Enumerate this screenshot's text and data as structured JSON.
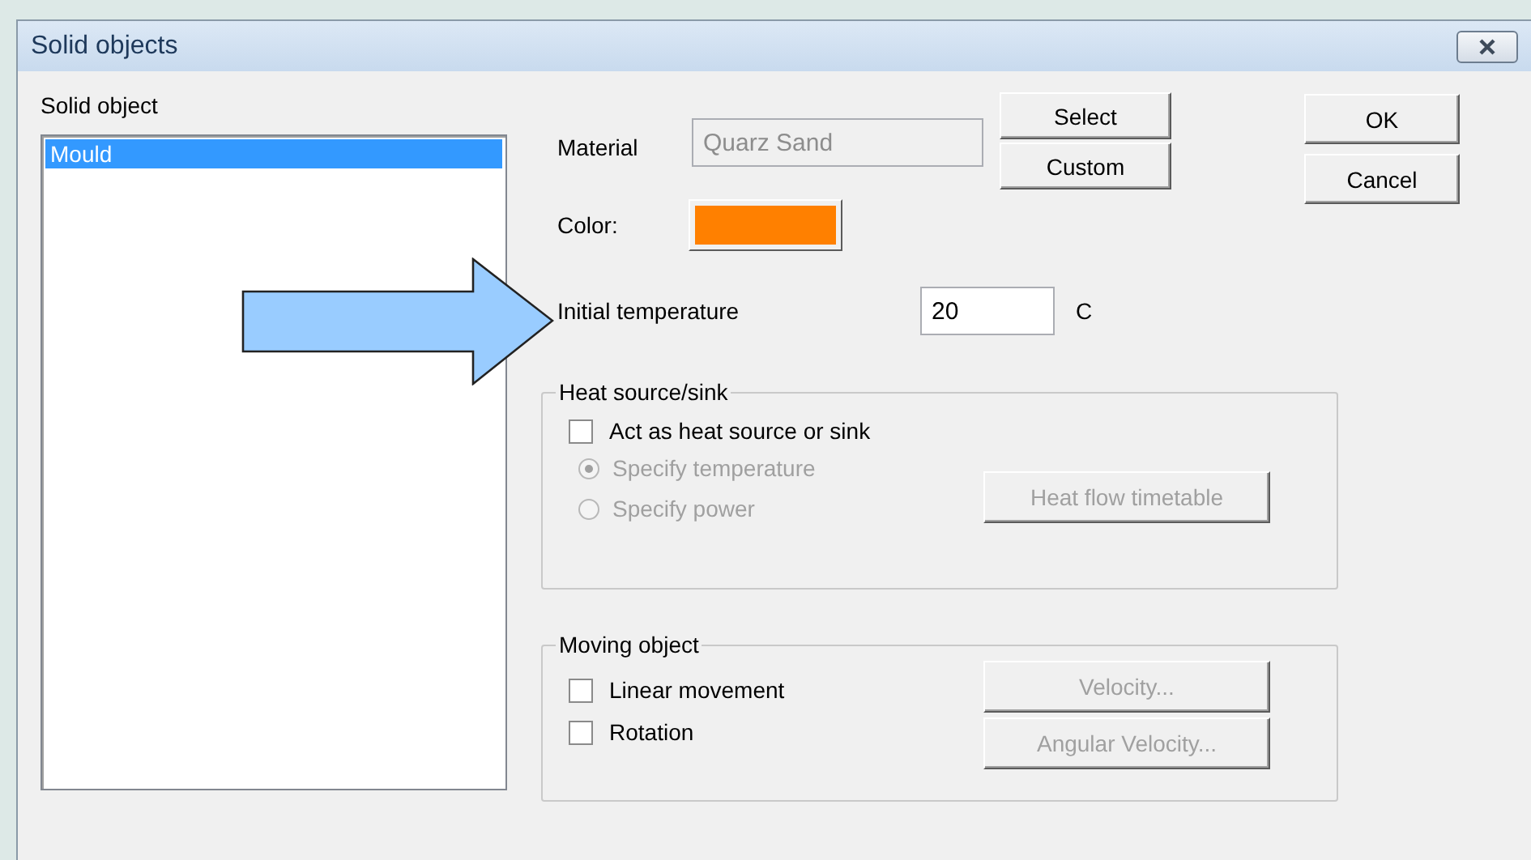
{
  "window": {
    "title": "Solid objects"
  },
  "solid_object_list": {
    "label": "Solid object",
    "items": [
      {
        "label": "Mould",
        "selected": true
      }
    ]
  },
  "material": {
    "label": "Material",
    "value": "Quarz Sand",
    "disabled": true
  },
  "material_buttons": [
    {
      "label": "Select"
    },
    {
      "label": "Custom"
    }
  ],
  "dialog_buttons": [
    {
      "label": "OK"
    },
    {
      "label": "Cancel"
    }
  ],
  "color": {
    "label": "Color:",
    "color": "#ff8000"
  },
  "initial_temperature": {
    "label": "Initial temperature",
    "value": "20",
    "unit": "C"
  },
  "heat_source": {
    "title": "Heat source/sink",
    "checkbox": {
      "label": "Act as heat source or sink",
      "checked": false
    },
    "options": [
      {
        "label": "Specify temperature",
        "selected": true,
        "disabled": true
      },
      {
        "label": "Specify power",
        "selected": false,
        "disabled": true
      }
    ],
    "button": {
      "label": "Heat flow timetable",
      "disabled": true
    }
  },
  "moving_object": {
    "title": "Moving object",
    "options": [
      {
        "label": "Linear movement",
        "checked": false
      },
      {
        "label": "Rotation",
        "checked": false
      }
    ],
    "buttons": [
      {
        "label": "Velocity...",
        "disabled": true
      },
      {
        "label": "Angular Velocity...",
        "disabled": true
      }
    ]
  }
}
